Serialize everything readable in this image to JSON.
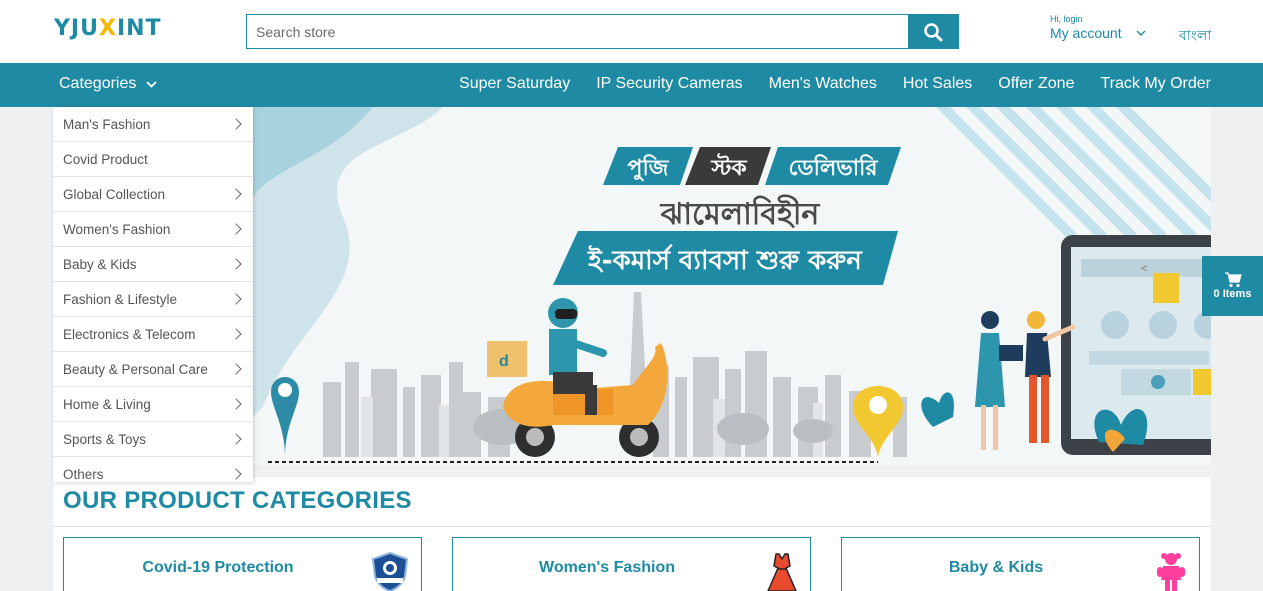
{
  "brand": {
    "logo_part1": "YJU",
    "logo_x": "X",
    "logo_part2": "INT"
  },
  "search": {
    "placeholder": "Search store"
  },
  "account": {
    "greeting": "Hi, login",
    "label": "My account"
  },
  "language": "বাংলা",
  "nav": {
    "categories_label": "Categories",
    "links": [
      "Super Saturday",
      "IP Security Cameras",
      "Men's Watches",
      "Hot Sales",
      "Offer Zone",
      "Track My Order"
    ]
  },
  "sidebar": {
    "items": [
      {
        "label": "Man's Fashion",
        "has_sub": true
      },
      {
        "label": "Covid Product",
        "has_sub": false
      },
      {
        "label": "Global Collection",
        "has_sub": true
      },
      {
        "label": "Women's Fashion",
        "has_sub": true
      },
      {
        "label": "Baby & Kids",
        "has_sub": true
      },
      {
        "label": "Fashion & Lifestyle",
        "has_sub": true
      },
      {
        "label": "Electronics & Telecom",
        "has_sub": true
      },
      {
        "label": "Beauty & Personal Care",
        "has_sub": true
      },
      {
        "label": "Home & Living",
        "has_sub": true
      },
      {
        "label": "Sports & Toys",
        "has_sub": true
      },
      {
        "label": "Others",
        "has_sub": true
      }
    ]
  },
  "banner": {
    "tag1": "পুজি",
    "tag2": "স্টক",
    "tag3": "ডেলিভারি",
    "headline": "ঝামেলাবিহীন",
    "subline": "ই-কমার্স ব্যাবসা শুরু করুন"
  },
  "cart": {
    "label": "0 Items"
  },
  "categories_section": {
    "title": "OUR PRODUCT CATEGORIES",
    "cards": [
      {
        "label": "Covid-19 Protection",
        "icon": "shield-icon"
      },
      {
        "label": "Women's Fashion",
        "icon": "dress-icon"
      },
      {
        "label": "Baby & Kids",
        "icon": "baby-icon"
      }
    ]
  },
  "colors": {
    "primary": "#1f8aa3",
    "accent": "#f5b800",
    "dark": "#3a3a3a"
  }
}
